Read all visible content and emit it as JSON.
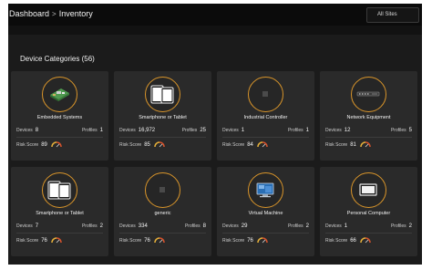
{
  "breadcrumb": {
    "root": "Dashboard",
    "separator": ">",
    "current": "Inventory"
  },
  "site_filter": {
    "selected": "All Sites"
  },
  "section": {
    "title": "Device Categories (56)"
  },
  "labels": {
    "devices": "Devices",
    "profiles": "Profiles",
    "risk": "Risk Score"
  },
  "colors": {
    "accent": "#d9952a",
    "gauge_low": "#e6b03a",
    "gauge_high": "#d9532c"
  },
  "cards": [
    {
      "name": "Embedded Systems",
      "devices": "8",
      "profiles": "1",
      "risk": "89",
      "icon": "circuit-board-icon"
    },
    {
      "name": "Smartphone or Tablet",
      "devices": "16,972",
      "profiles": "25",
      "risk": "85",
      "icon": "tablet-icon"
    },
    {
      "name": "Industrial Controller",
      "devices": "1",
      "profiles": "1",
      "risk": "84",
      "icon": "placeholder-icon"
    },
    {
      "name": "Network Equipment",
      "devices": "12",
      "profiles": "5",
      "risk": "81",
      "icon": "network-switch-icon"
    },
    {
      "name": "Smartphone or Tablet",
      "devices": "7",
      "profiles": "2",
      "risk": "76",
      "icon": "tablet-icon"
    },
    {
      "name": "generic",
      "devices": "334",
      "profiles": "8",
      "risk": "76",
      "icon": "placeholder-icon"
    },
    {
      "name": "Virtual Machine",
      "devices": "29",
      "profiles": "2",
      "risk": "76",
      "icon": "virtual-machine-icon"
    },
    {
      "name": "Personal Computer",
      "devices": "1",
      "profiles": "2",
      "risk": "66",
      "icon": "monitor-icon"
    }
  ]
}
